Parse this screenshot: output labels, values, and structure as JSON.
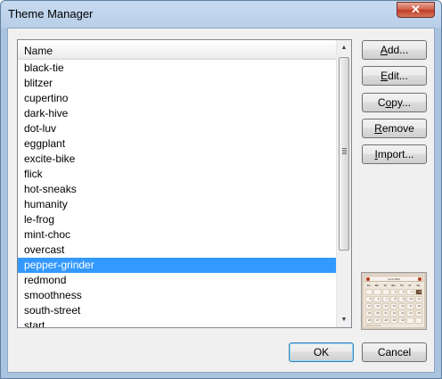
{
  "window": {
    "title": "Theme Manager",
    "close_glyph": "✕"
  },
  "list": {
    "column_header": "Name",
    "items": [
      "black-tie",
      "blitzer",
      "cupertino",
      "dark-hive",
      "dot-luv",
      "eggplant",
      "excite-bike",
      "flick",
      "hot-sneaks",
      "humanity",
      "le-frog",
      "mint-choc",
      "overcast",
      "pepper-grinder",
      "redmond",
      "smoothness",
      "south-street",
      "start"
    ],
    "selected_index": 13,
    "selected_color": "#3399ff"
  },
  "buttons": {
    "add": {
      "mnemonic": "A",
      "rest": "dd..."
    },
    "edit": {
      "mnemonic": "E",
      "rest": "dit..."
    },
    "copy": {
      "pre": "C",
      "mnemonic": "o",
      "rest": "py..."
    },
    "remove": {
      "mnemonic": "R",
      "rest": "emove"
    },
    "import": {
      "mnemonic": "I",
      "rest": "mport..."
    },
    "ok": "OK",
    "cancel": "Cancel"
  },
  "preview": {
    "month_label": "April 2009",
    "day_headers": [
      "Su",
      "Mo",
      "Tu",
      "We",
      "Th",
      "Fr",
      "Sa"
    ],
    "days": [
      "",
      "",
      "",
      "1",
      "2",
      "3",
      "4",
      "5",
      "6",
      "7",
      "8",
      "9",
      "10",
      "11",
      "12",
      "13",
      "14",
      "15",
      "16",
      "17",
      "18",
      "19",
      "20",
      "21",
      "22",
      "23",
      "24",
      "25",
      "26",
      "27",
      "28",
      "29",
      "30",
      "",
      "",
      "",
      ""
    ],
    "today": "4"
  }
}
